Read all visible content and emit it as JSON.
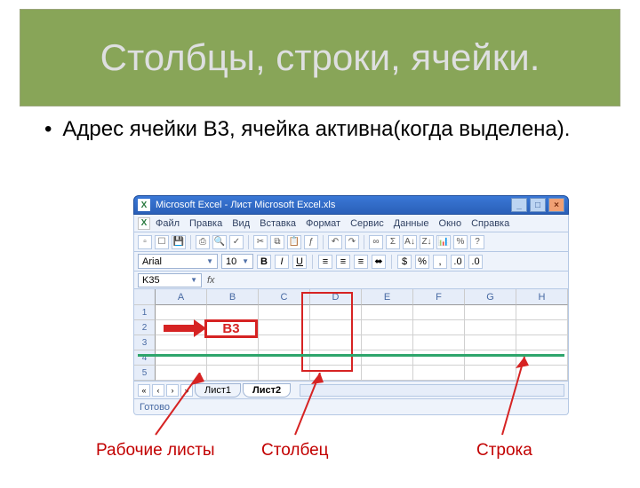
{
  "title": "Столбцы, строки, ячейки.",
  "bullet": "Адрес ячейки В3, ячейка активна(когда выделена).",
  "window": {
    "title": "Microsoft Excel - Лист Microsoft Excel.xls",
    "menu": [
      "Файл",
      "Правка",
      "Вид",
      "Вставка",
      "Формат",
      "Сервис",
      "Данные",
      "Окно",
      "Справка"
    ],
    "toolbar_icons": [
      "new",
      "open",
      "save",
      "mail",
      "print",
      "preview",
      "spell",
      "cut",
      "copy",
      "paste",
      "format-painter",
      "undo",
      "redo",
      "link",
      "sum",
      "sort-asc",
      "sort-desc",
      "chart",
      "zoom",
      "help"
    ],
    "font_name": "Arial",
    "font_size": "10",
    "format_buttons": [
      "B",
      "I",
      "U"
    ],
    "name_box": "K35",
    "fx": "fx",
    "columns": [
      "A",
      "B",
      "C",
      "D",
      "E",
      "F",
      "G",
      "H"
    ],
    "rows": [
      "1",
      "2",
      "3",
      "4",
      "5"
    ],
    "sheet_tabs": {
      "inactive": "Лист1",
      "active": "Лист2"
    },
    "status": "Готово"
  },
  "annotations": {
    "active_cell_label": "B3",
    "sheets_label": "Рабочие листы",
    "column_label": "Столбец",
    "row_label": "Строка"
  }
}
